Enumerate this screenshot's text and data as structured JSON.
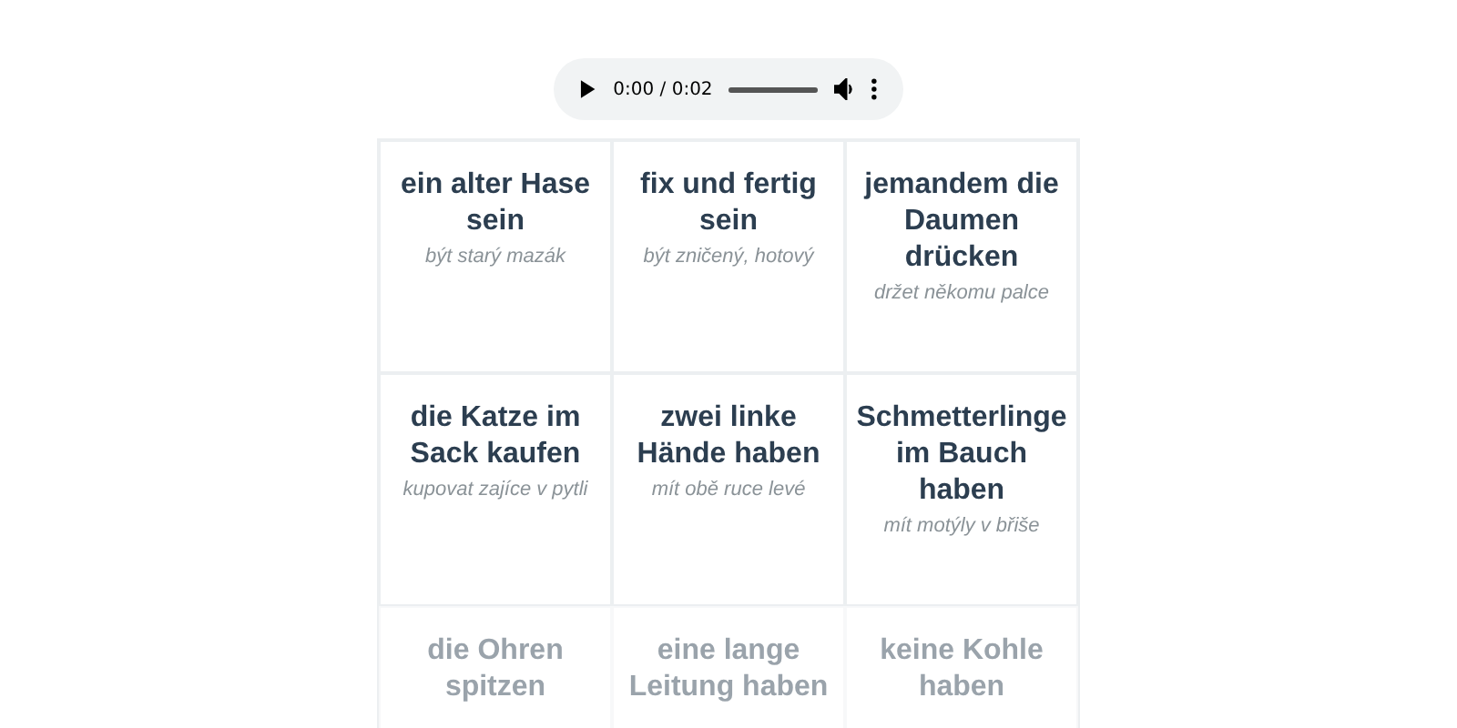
{
  "audio_player": {
    "time": "0:00 / 0:02",
    "level": 1.0
  },
  "cards": [
    {
      "phrase": "ein alter Hase sein",
      "translation": "být starý mazák",
      "faded": false
    },
    {
      "phrase": "fix und fertig sein",
      "translation": "být zničený, hotový",
      "faded": false
    },
    {
      "phrase": "jemandem die Daumen drücken",
      "translation": "držet někomu palce",
      "faded": false
    },
    {
      "phrase": "die Katze im Sack kaufen",
      "translation": "kupovat zajíce v pytli",
      "faded": false
    },
    {
      "phrase": "zwei linke Hände haben",
      "translation": "mít obě ruce levé",
      "faded": false
    },
    {
      "phrase": "Schmetterlinge im Bauch haben",
      "translation": "mít motýly v břiše",
      "faded": false
    },
    {
      "phrase": "die Ohren spitzen",
      "faded": true
    },
    {
      "phrase": "eine lange Leitung haben",
      "faded": true
    },
    {
      "phrase": "keine Kohle haben",
      "faded": true
    }
  ]
}
